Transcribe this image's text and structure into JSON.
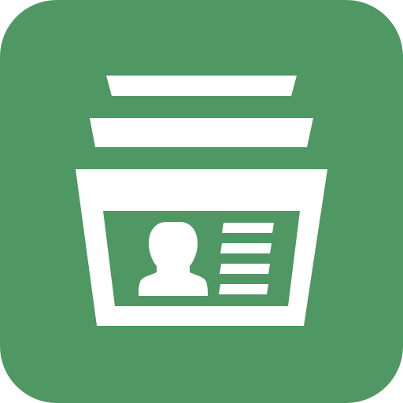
{
  "app_icon": {
    "name": "contacts-card-stack",
    "background_color": "#4f9763",
    "foreground_color": "#ffffff",
    "icons": [
      "card-stack-icon",
      "person-silhouette-icon",
      "text-lines-icon"
    ]
  }
}
